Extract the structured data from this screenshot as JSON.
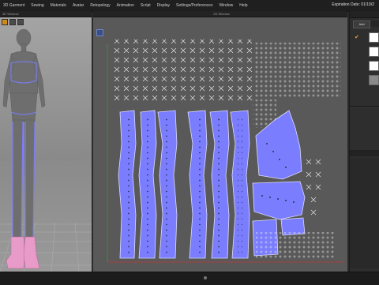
{
  "menu": {
    "items": [
      "3D Garment",
      "Sewing",
      "Materials",
      "Avatar",
      "Retopology",
      "Animation",
      "Script",
      "Display",
      "Settings/Preferences",
      "Window",
      "Help"
    ],
    "expiration": "Expiration Date: 01/19/2"
  },
  "windows": {
    "w3d_title": "3D Window",
    "w2d_title": "2D Window"
  },
  "right_panel": {
    "tab_active": "Add",
    "tab_other": "",
    "swatch_colors": [
      "#ffffff",
      "#ffffff",
      "#ffffff",
      "#8a8a8a"
    ]
  },
  "colors": {
    "pattern_fill": "#7b7dff",
    "pattern_edge": "#dcdcff",
    "stitch": "#e6e6e6",
    "axis_green": "#3a9a3a",
    "axis_red": "#c03a3a",
    "accent_orange": "#e8a43a",
    "boot_pink": "#e89ac8"
  }
}
